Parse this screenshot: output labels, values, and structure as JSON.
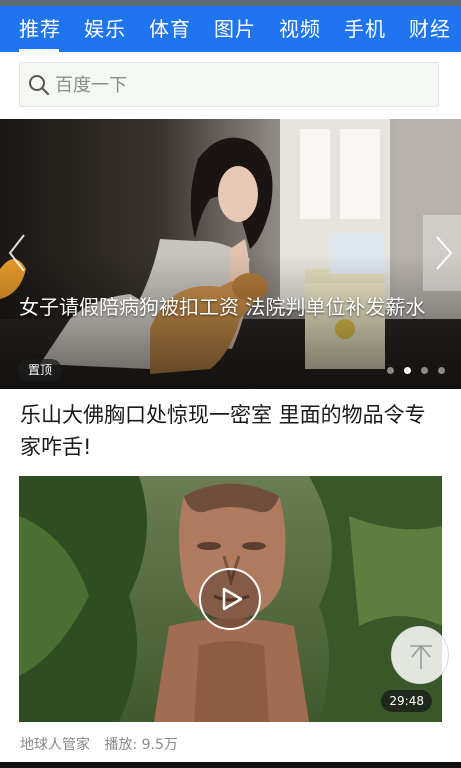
{
  "nav": {
    "tabs": [
      {
        "label": "推荐",
        "active": true
      },
      {
        "label": "娱乐",
        "active": false
      },
      {
        "label": "体育",
        "active": false
      },
      {
        "label": "图片",
        "active": false
      },
      {
        "label": "视频",
        "active": false
      },
      {
        "label": "手机",
        "active": false
      },
      {
        "label": "财经",
        "active": false
      }
    ],
    "background_color": "#1f74f0"
  },
  "search": {
    "placeholder": "百度一下",
    "icon": "search-icon"
  },
  "carousel": {
    "caption": "女子请假陪病狗被扣工资 法院判单位补发薪水",
    "badge": "置顶",
    "slide_count": 4,
    "active_slide": 2,
    "prev_icon": "chevron-left-icon",
    "next_icon": "chevron-right-icon"
  },
  "article": {
    "title": "乐山大佛胸口处惊现一密室 里面的物品令专家咋舌!",
    "video": {
      "duration": "29:48",
      "play_icon": "play-icon"
    },
    "source": "地球人管家",
    "plays": "播放: 9.5万"
  },
  "floating": {
    "back_to_top_icon": "arrow-up-icon"
  }
}
